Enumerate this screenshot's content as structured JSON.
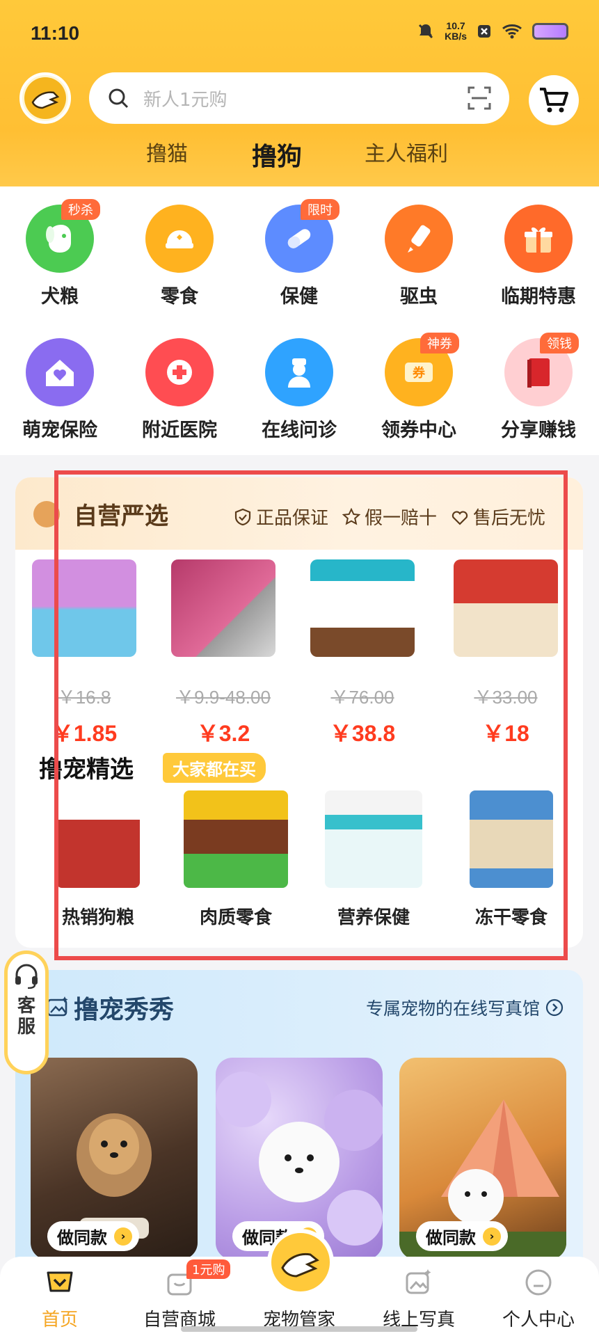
{
  "status": {
    "time": "11:10",
    "speed": "10.7",
    "speed_unit": "KB/s"
  },
  "search": {
    "placeholder": "新人1元购"
  },
  "tabs": [
    {
      "label": "撸猫",
      "active": false
    },
    {
      "label": "撸狗",
      "active": true
    },
    {
      "label": "主人福利",
      "active": false
    }
  ],
  "categories": [
    {
      "label": "犬粮",
      "badge": "秒杀",
      "color": "#4ccb52",
      "icon": "dog-icon"
    },
    {
      "label": "零食",
      "badge": "",
      "color": "#ffb21f",
      "icon": "snack-bowl-icon"
    },
    {
      "label": "保健",
      "badge": "限时",
      "color": "#5d8cff",
      "icon": "pill-icon"
    },
    {
      "label": "驱虫",
      "badge": "",
      "color": "#ff7a28",
      "icon": "dropper-icon"
    },
    {
      "label": "临期特惠",
      "badge": "",
      "color": "#ff6a2a",
      "icon": "gift-icon"
    },
    {
      "label": "萌宠保险",
      "badge": "",
      "color": "#8a6cf0",
      "icon": "house-heart-icon"
    },
    {
      "label": "附近医院",
      "badge": "",
      "color": "#ff4d52",
      "icon": "medical-cross-icon"
    },
    {
      "label": "在线问诊",
      "badge": "",
      "color": "#2fa3ff",
      "icon": "doctor-icon"
    },
    {
      "label": "领券中心",
      "badge": "神券",
      "color": "#ffb21f",
      "icon": "coupon-icon"
    },
    {
      "label": "分享赚钱",
      "badge": "领钱",
      "color": "#ffcfd2",
      "icon": "red-book-icon"
    }
  ],
  "self_run": {
    "title": "自营严选",
    "guarantees": [
      "正品保证",
      "假一赔十",
      "售后无忧"
    ],
    "products": [
      {
        "orig": "￥16.8",
        "price": "￥1.85",
        "color": "#c37bd6"
      },
      {
        "orig": "￥9.9-48.00",
        "price": "￥3.2",
        "color": "#b63a6a"
      },
      {
        "orig": "￥76.00",
        "price": "￥38.8",
        "color": "#27b6c9"
      },
      {
        "orig": "￥33.00",
        "price": "￥18",
        "color": "#d53b30"
      }
    ]
  },
  "picks": {
    "title": "撸宠精选",
    "tag": "大家都在买",
    "items": [
      {
        "label": "热销狗粮",
        "color": "#c2342d"
      },
      {
        "label": "肉质零食",
        "color": "#7a3b20"
      },
      {
        "label": "营养保健",
        "color": "#37c0cc"
      },
      {
        "label": "冻干零食",
        "color": "#4c8fd0"
      }
    ]
  },
  "show": {
    "title": "撸宠秀秀",
    "subtitle": "专属宠物的在线写真馆",
    "tiles": [
      {
        "button": "做同款",
        "bg": "#6b4a34"
      },
      {
        "button": "做同款",
        "bg": "#c7b0ea"
      },
      {
        "button": "做同款",
        "bg": "#d9893a"
      }
    ]
  },
  "service": {
    "label": "客服"
  },
  "nav": [
    {
      "label": "首页",
      "active": true,
      "badge": ""
    },
    {
      "label": "自营商城",
      "active": false,
      "badge": "1元购"
    },
    {
      "label": "宠物管家",
      "active": false,
      "badge": ""
    },
    {
      "label": "线上写真",
      "active": false,
      "badge": ""
    },
    {
      "label": "个人中心",
      "active": false,
      "badge": ""
    }
  ]
}
